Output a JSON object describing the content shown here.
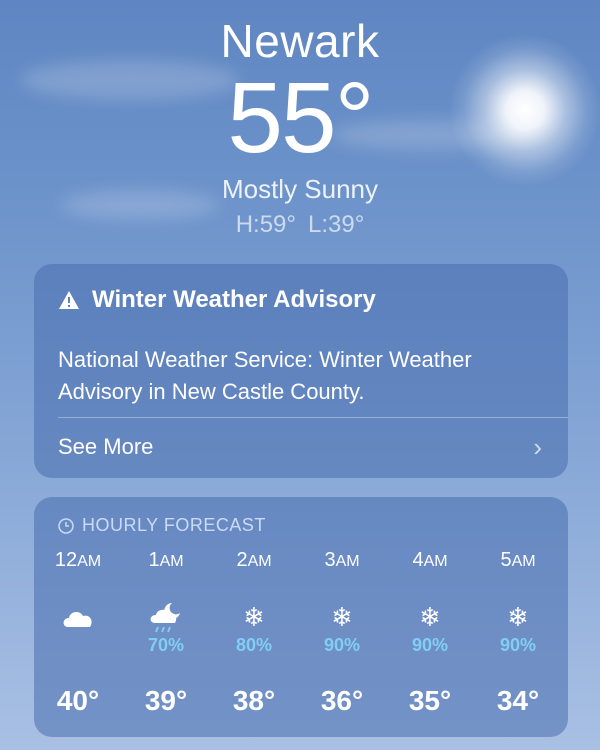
{
  "header": {
    "city": "Newark",
    "temperature": "55°",
    "condition": "Mostly Sunny",
    "high": "H:59°",
    "low": "L:39°"
  },
  "advisory": {
    "icon": "warning-triangle-icon",
    "title": "Winter Weather Advisory",
    "body": "National Weather Service: Winter Weather Advisory in New Castle County.",
    "link_label": "See More"
  },
  "hourly": {
    "heading": "HOURLY FORECAST",
    "hours": [
      {
        "time": "12",
        "suffix": "AM",
        "icon": "cloud-icon",
        "precip": "",
        "temp": "40°"
      },
      {
        "time": "1",
        "suffix": "AM",
        "icon": "cloud-moon-rain-icon",
        "precip": "70%",
        "temp": "39°"
      },
      {
        "time": "2",
        "suffix": "AM",
        "icon": "snowflake-icon",
        "precip": "80%",
        "temp": "38°"
      },
      {
        "time": "3",
        "suffix": "AM",
        "icon": "snowflake-icon",
        "precip": "90%",
        "temp": "36°"
      },
      {
        "time": "4",
        "suffix": "AM",
        "icon": "snowflake-icon",
        "precip": "90%",
        "temp": "35°"
      },
      {
        "time": "5",
        "suffix": "AM",
        "icon": "snowflake-icon",
        "precip": "90%",
        "temp": "34°"
      }
    ]
  },
  "colors": {
    "sky_top": "#5f86c2",
    "sky_bottom": "#a9c0e4",
    "precip_accent": "#7fd0f0"
  }
}
